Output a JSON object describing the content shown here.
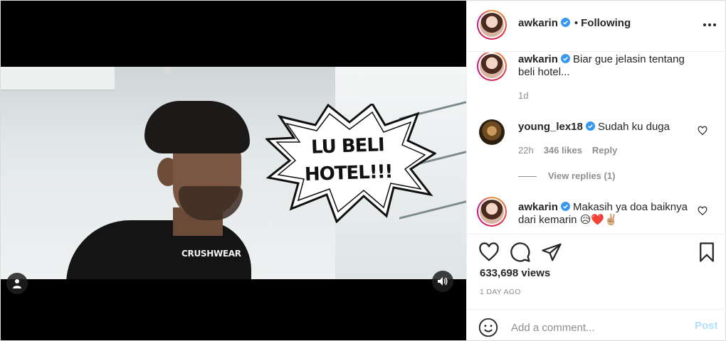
{
  "header": {
    "username": "awkarin",
    "separator": "•",
    "follow_status": "Following"
  },
  "media": {
    "bubble_line1": "LU BELI",
    "bubble_line2": "HOTEL!!!",
    "shirt_text": "CRUSHWEAR"
  },
  "comments": [
    {
      "username": "awkarin",
      "text": "Biar gue jelasin tentang beli hotel...",
      "time": "1d"
    },
    {
      "username": "young_lex18",
      "text": "Sudah ku duga",
      "time": "22h",
      "likes": "346 likes",
      "reply_label": "Reply",
      "view_replies": "View replies (1)"
    },
    {
      "username": "awkarin",
      "text": "Makasih ya doa baiknya dari kemarin 😥❤️✌🏼"
    }
  ],
  "stats": {
    "views": "633,698 views",
    "posted": "1 DAY AGO"
  },
  "add_comment": {
    "placeholder": "Add a comment...",
    "post_label": "Post"
  },
  "colors": {
    "verified": "#3897f0",
    "post_disabled": "#b2dffc",
    "muted": "#8e8e8e"
  },
  "icons": [
    "more-icon",
    "verified-icon",
    "heart-icon",
    "comment-icon",
    "share-icon",
    "bookmark-icon",
    "smile-icon",
    "person-icon",
    "sound-icon"
  ]
}
